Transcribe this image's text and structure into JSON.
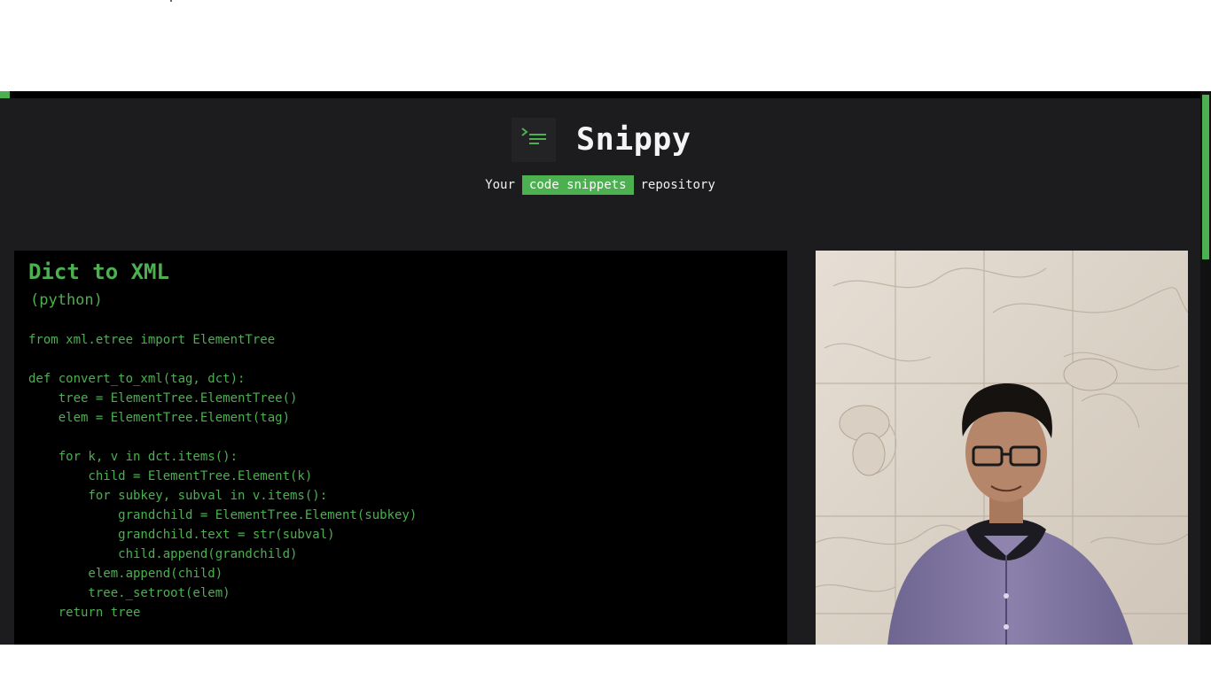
{
  "brand": {
    "title": "Snippy",
    "icon": "terminal-lines-icon",
    "tagline_pre": "Your",
    "tagline_highlight": "code snippets",
    "tagline_post": "repository"
  },
  "snippet": {
    "title": "Dict to XML",
    "language": "(python)",
    "code": "from xml.etree import ElementTree\n\ndef convert_to_xml(tag, dct):\n    tree = ElementTree.ElementTree()\n    elem = ElementTree.Element(tag)\n\n    for k, v in dct.items():\n        child = ElementTree.Element(k)\n        for subkey, subval in v.items():\n            grandchild = ElementTree.Element(subkey)\n            grandchild.text = str(subval)\n            child.append(grandchild)\n        elem.append(child)\n        tree._setroot(elem)\n    return tree"
  },
  "profile": {
    "photo": "author-photo"
  },
  "colors": {
    "accent": "#4caf50",
    "background": "#1c1c1e",
    "card": "#000000",
    "text": "#f4f4f4"
  }
}
